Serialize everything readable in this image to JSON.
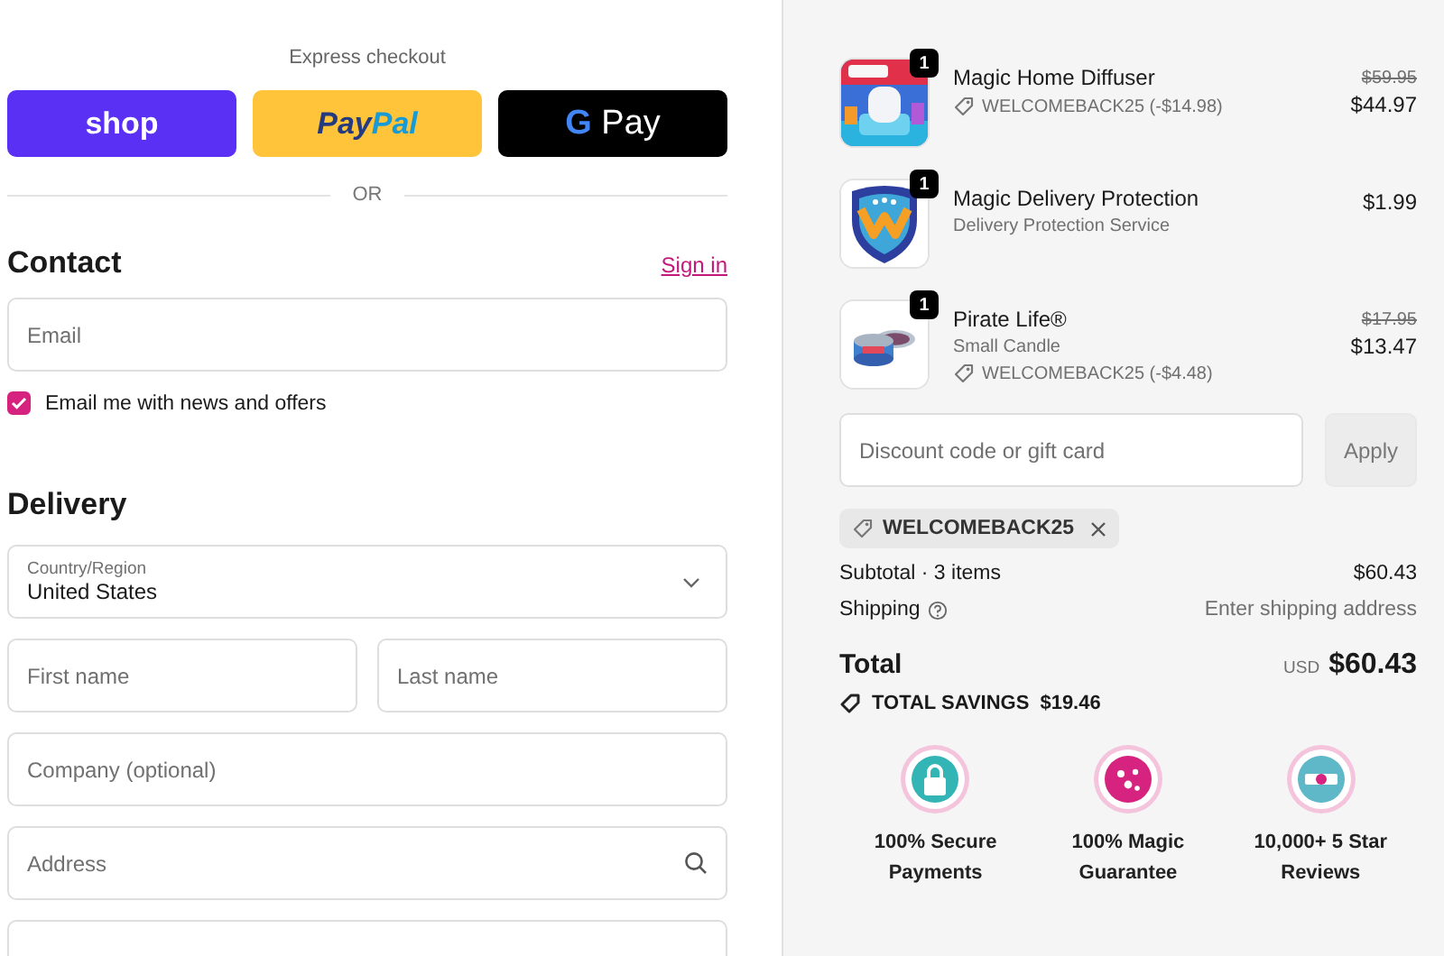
{
  "express_checkout": {
    "title": "Express checkout",
    "buttons": [
      {
        "kind": "shop",
        "parts": [
          "shop"
        ]
      },
      {
        "kind": "paypal",
        "parts": [
          "Pay",
          "Pal"
        ]
      },
      {
        "kind": "gpay",
        "parts": [
          "G",
          "Pay"
        ]
      }
    ],
    "divider": "OR"
  },
  "contact": {
    "heading": "Contact",
    "sign_in": "Sign in",
    "email": {
      "placeholder": "Email"
    },
    "newsletter": {
      "label": "Email me with news and offers",
      "checked": true
    }
  },
  "delivery": {
    "heading": "Delivery",
    "fields": [
      {
        "kind": "select",
        "label": "Country/Region",
        "value": "United States"
      },
      {
        "kind": "pair",
        "fields": [
          {
            "placeholder": "First name"
          },
          {
            "placeholder": "Last name"
          }
        ]
      },
      {
        "kind": "text",
        "placeholder": "Company (optional)"
      },
      {
        "kind": "search",
        "placeholder": "Address"
      },
      {
        "kind": "text"
      }
    ]
  },
  "order_summary": {
    "items": [
      {
        "kind": "diffuser",
        "quantity": "1",
        "name": "Magic Home Diffuser",
        "discount": "WELCOMEBACK25 (-$14.98)",
        "original_price": "$59.95",
        "price": "$44.97"
      },
      {
        "kind": "shield",
        "quantity": "1",
        "name": "Magic Delivery Protection",
        "subtitle": "Delivery Protection Service",
        "price": "$1.99"
      },
      {
        "kind": "candle",
        "quantity": "1",
        "name": "Pirate Life®",
        "subtitle": "Small Candle",
        "discount": "WELCOMEBACK25 (-$4.48)",
        "original_price": "$17.95",
        "price": "$13.47"
      }
    ],
    "discount_field": {
      "placeholder": "Discount code or gift card"
    },
    "apply_button": "Apply",
    "applied_code": "WELCOMEBACK25",
    "subtotal": {
      "label": "Subtotal · 3 items",
      "value": "$60.43"
    },
    "shipping": {
      "label": "Shipping",
      "value": "Enter shipping address"
    },
    "total": {
      "label": "Total",
      "currency": "USD",
      "value": "$60.43"
    },
    "savings": {
      "label": "TOTAL SAVINGS",
      "value": "$19.46"
    },
    "trust_badges": [
      {
        "kind": "lock",
        "color": "#33b5b5",
        "label": "100% Secure Payments"
      },
      {
        "kind": "stars",
        "color": "#d6237f",
        "label": "100% Magic Guarantee"
      },
      {
        "kind": "ribbon",
        "color": "#5fb8c8",
        "label": "10,000+ 5 Star Reviews"
      }
    ]
  }
}
